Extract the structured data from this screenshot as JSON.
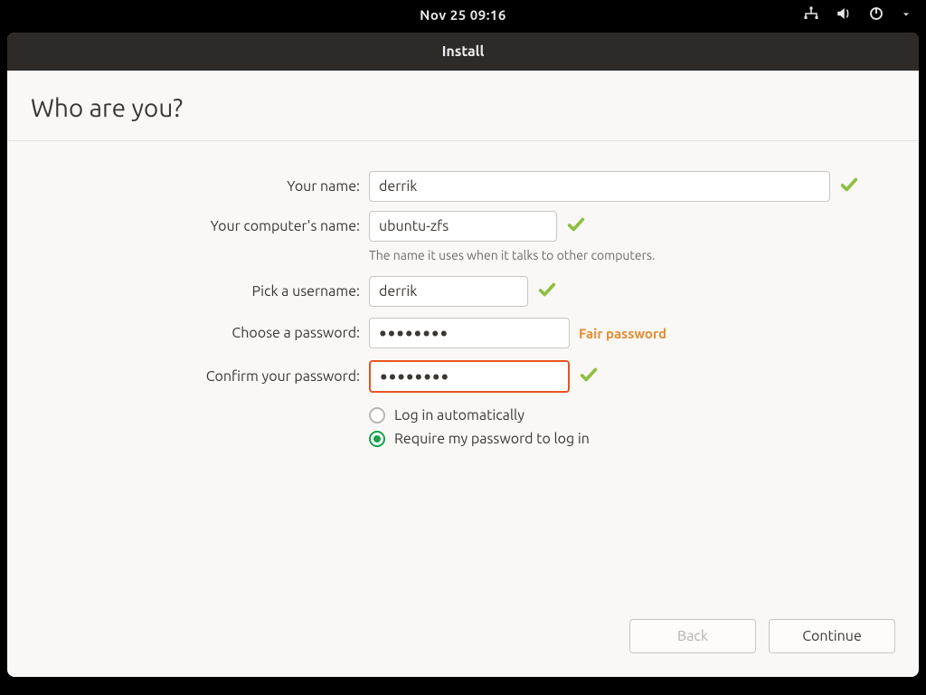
{
  "topbar": {
    "clock": "Nov 25  09:16"
  },
  "window": {
    "title": "Install"
  },
  "page": {
    "heading": "Who are you?"
  },
  "form": {
    "name": {
      "label": "Your name:",
      "value": "derrik",
      "valid": true
    },
    "hostname": {
      "label": "Your computer's name:",
      "value": "ubuntu-zfs",
      "valid": true,
      "hint": "The name it uses when it talks to other computers."
    },
    "username": {
      "label": "Pick a username:",
      "value": "derrik",
      "valid": true
    },
    "password": {
      "label": "Choose a password:",
      "value": "••••••••",
      "strength": "Fair password"
    },
    "confirm": {
      "label": "Confirm your password:",
      "value": "••••••••",
      "valid": true,
      "focused": true
    },
    "radio": {
      "auto": "Log in automatically",
      "require": "Require my password to log in",
      "selected": "require"
    }
  },
  "footer": {
    "back": "Back",
    "continue": "Continue"
  }
}
